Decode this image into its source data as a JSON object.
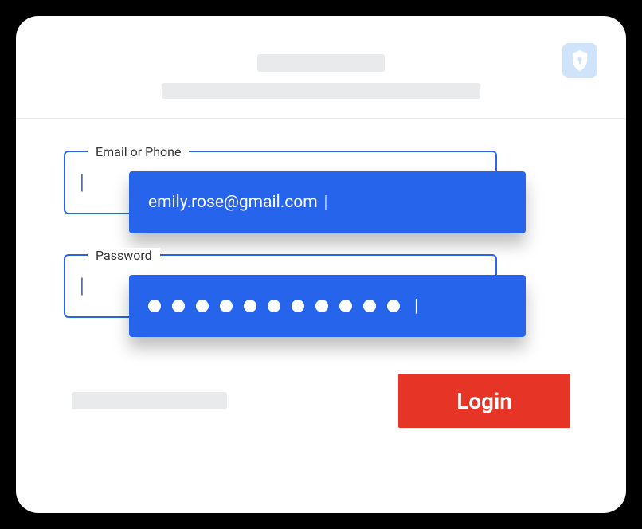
{
  "header": {
    "title": "",
    "subtitle": ""
  },
  "shield_icon": "lock-shield-icon",
  "form": {
    "email_field": {
      "label": "Email or Phone",
      "value": "",
      "autofill_value": "emily.rose@gmail.com"
    },
    "password_field": {
      "label": "Password",
      "value": "",
      "autofill_masked_length": 11
    }
  },
  "footer": {
    "link_text": "",
    "login_button_label": "Login"
  },
  "colors": {
    "primary_blue": "#2664eb",
    "action_red": "#e63427",
    "shield_bg": "#cfe3fb"
  }
}
